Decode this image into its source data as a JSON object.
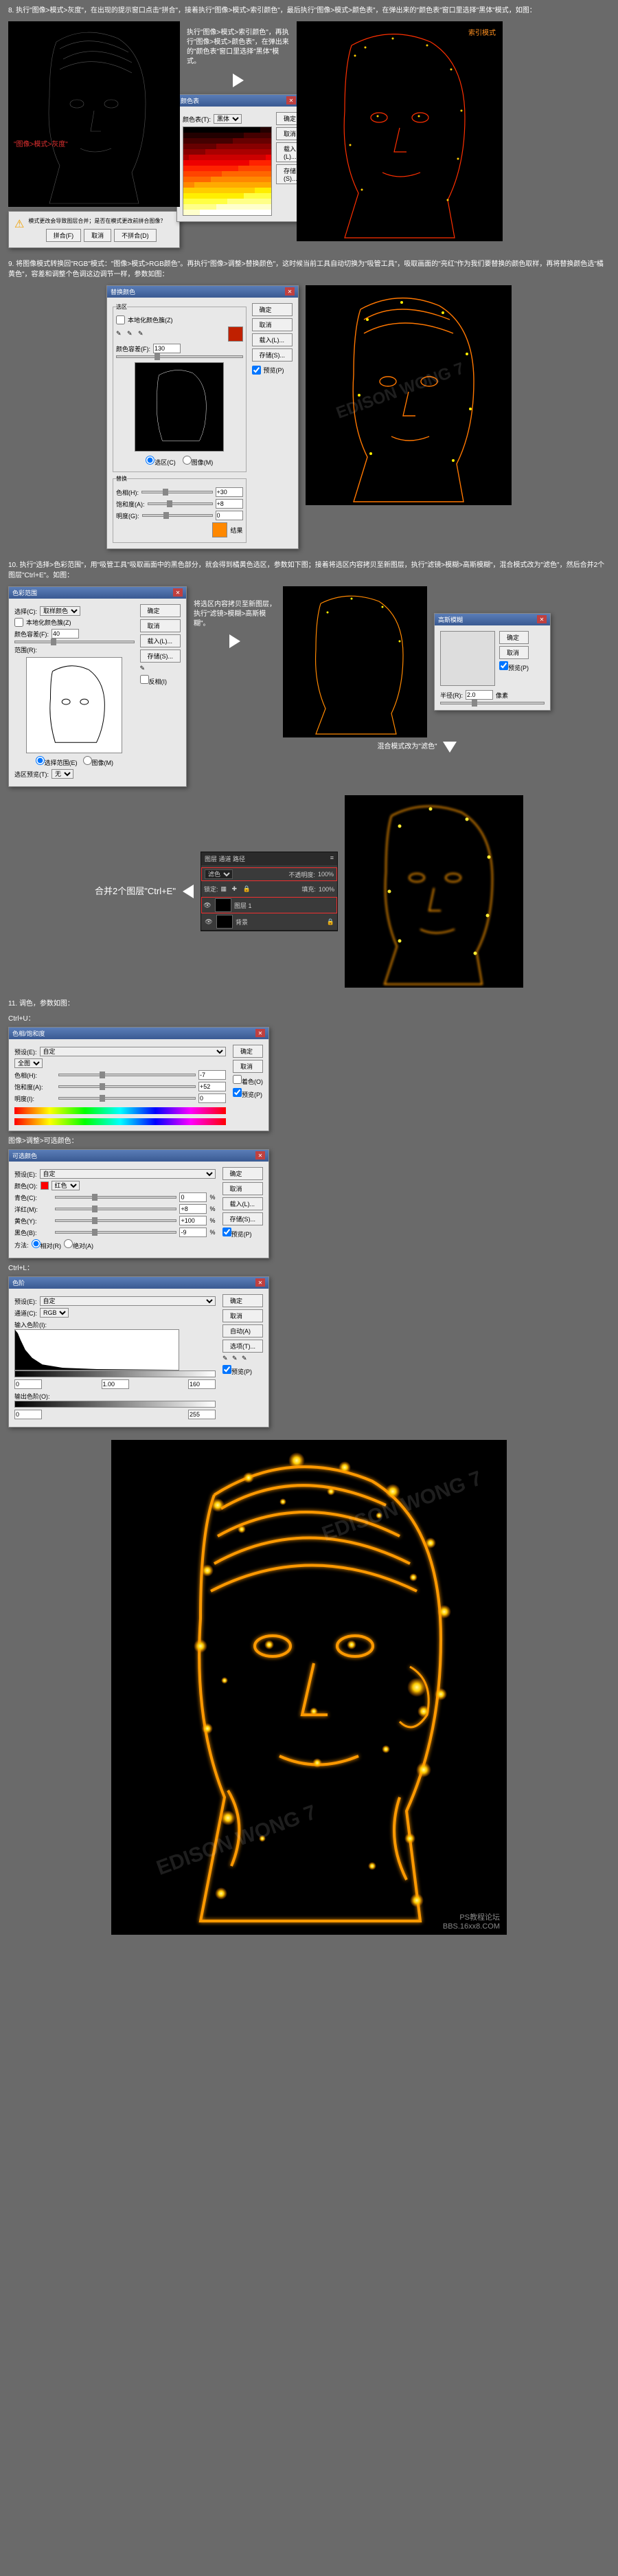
{
  "step8": {
    "text": "8. 执行\"图像>模式>灰度\"，在出现的提示窗口点击\"拼合\"，接着执行\"图像>模式>索引颜色\"，最后执行\"图像>模式>颜色表\"，在弹出来的\"颜色表\"窗口里选择\"黑体\"模式，如图：",
    "label_gray": "\"图像>模式>灰度\"",
    "annotation": "执行\"图像>模式>索引颜色\"，再执行\"图像>模式>颜色表\"，在弹出来的\"颜色表\"窗口里选择\"黑体\"模式。",
    "label_indexed": "索引模式",
    "color_table": {
      "title": "颜色表",
      "mode_label": "颜色表(T):",
      "mode_value": "黑体",
      "ok": "确定",
      "cancel": "取消",
      "load": "载入(L)...",
      "save": "存储(S)..."
    },
    "alert": {
      "text": "模式更改会导致图层合并；是否在模式更改前拼合图像？",
      "flatten": "拼合(F)",
      "cancel": "取消",
      "dont": "不拼合(D)"
    }
  },
  "step9": {
    "text": "9. 将图像模式转换回\"RGB\"模式：\"图像>模式>RGB颜色\"。再执行\"图像>调整>替换颜色\"，这时候当前工具自动切换为\"吸管工具\"，吸取画面的\"亮红\"作为我们要替换的颜色取样，再将替换颜色选\"橘黄色\"，容差和调整个色调这边调节一样，参数如图：",
    "replace": {
      "title": "替换颜色",
      "selection_label": "选区",
      "localized": "本地化颜色簇(Z)",
      "fuzziness": "颜色容差(F):",
      "fuzziness_val": "130",
      "ok": "确定",
      "cancel": "取消",
      "load": "载入(L)...",
      "save": "存储(S)...",
      "preview": "预览(P)",
      "radio_sel": "选区(C)",
      "radio_img": "图像(M)",
      "replace_label": "替换",
      "hue": "色相(H):",
      "hue_val": "+30",
      "sat": "饱和度(A):",
      "sat_val": "+8",
      "light": "明度(G):",
      "light_val": "0",
      "result": "结果"
    }
  },
  "step10": {
    "text": "10. 执行\"选择>色彩范围\"，用\"吸管工具\"吸取画面中的黑色部分，就会得到橘黄色选区，参数如下图；接着将选区内容拷贝至新图层，执行\"滤镜>模糊>高斯模糊\"，混合模式改为\"滤色\"，然后合并2个图层\"Ctrl+E\"。如图：",
    "color_range": {
      "title": "色彩范围",
      "select_label": "选择(C):",
      "select_val": "取样颜色",
      "localized": "本地化颜色簇(Z)",
      "fuzziness": "颜色容差(F):",
      "fuzziness_val": "40",
      "range": "范围(R):",
      "ok": "确定",
      "cancel": "取消",
      "load": "载入(L)...",
      "save": "存储(S)...",
      "radio_sel": "选择范围(E)",
      "radio_img": "图像(M)",
      "preview": "选区预览(T):",
      "preview_val": "无",
      "invert": "反相(I)"
    },
    "anno1": "将选区内容拷贝至新图层，执行\"滤镜>模糊>高斯模糊\"。",
    "gauss": {
      "title": "高斯模糊",
      "ok": "确定",
      "cancel": "取消",
      "preview": "预览(P)",
      "radius": "半径(R):",
      "radius_val": "2.0",
      "unit": "像素"
    },
    "anno2": "混合模式改为\"滤色\"",
    "merge": "合并2个图层\"Ctrl+E\"",
    "layers": {
      "tabs": "图层  通道  路径",
      "mode": "滤色",
      "opacity_label": "不透明度:",
      "opacity_val": "100%",
      "lock": "锁定:",
      "fill_label": "填充:",
      "fill_val": "100%",
      "layer1": "图层 1",
      "bg": "背景"
    }
  },
  "step11": {
    "text": "11. 调色，参数如图：",
    "hue_sat_label": "Ctrl+U：",
    "hue_sat": {
      "title": "色相/饱和度",
      "preset": "预设(E):",
      "preset_val": "自定",
      "master": "全图",
      "hue": "色相(H):",
      "hue_val": "-7",
      "sat": "饱和度(A):",
      "sat_val": "+52",
      "light": "明度(I):",
      "light_val": "0",
      "colorize": "着色(O)",
      "preview": "预览(P)",
      "ok": "确定",
      "cancel": "取消"
    },
    "sel_color_label": "图像>调整>可选颜色：",
    "sel_color": {
      "title": "可选颜色",
      "preset": "预设(E):",
      "preset_val": "自定",
      "colors": "颜色(O):",
      "colors_val": "红色",
      "cyan": "青色(C):",
      "cyan_val": "0",
      "magenta": "洋红(M):",
      "magenta_val": "+8",
      "yellow": "黄色(Y):",
      "yellow_val": "+100",
      "black": "黑色(B):",
      "black_val": "-9",
      "method": "方法:",
      "rel": "相对(R)",
      "abs": "绝对(A)",
      "ok": "确定",
      "cancel": "取消",
      "load": "载入(L)...",
      "save": "存储(S)...",
      "preview": "预览(P)"
    },
    "levels_label": "Ctrl+L：",
    "levels": {
      "title": "色阶",
      "preset": "预设(E):",
      "preset_val": "自定",
      "channel": "通道(C):",
      "channel_val": "RGB",
      "input": "输入色阶(I):",
      "in1": "0",
      "in2": "1.00",
      "in3": "160",
      "output": "输出色阶(O):",
      "out1": "0",
      "out2": "255",
      "ok": "确定",
      "cancel": "取消",
      "auto": "自动(A)",
      "options": "选项(T)...",
      "preview": "预览(P)"
    }
  },
  "footer": {
    "credit": "PS教程论坛",
    "site": "BBS.16xx8.COM"
  },
  "watermark": "EDISON WONG 7"
}
